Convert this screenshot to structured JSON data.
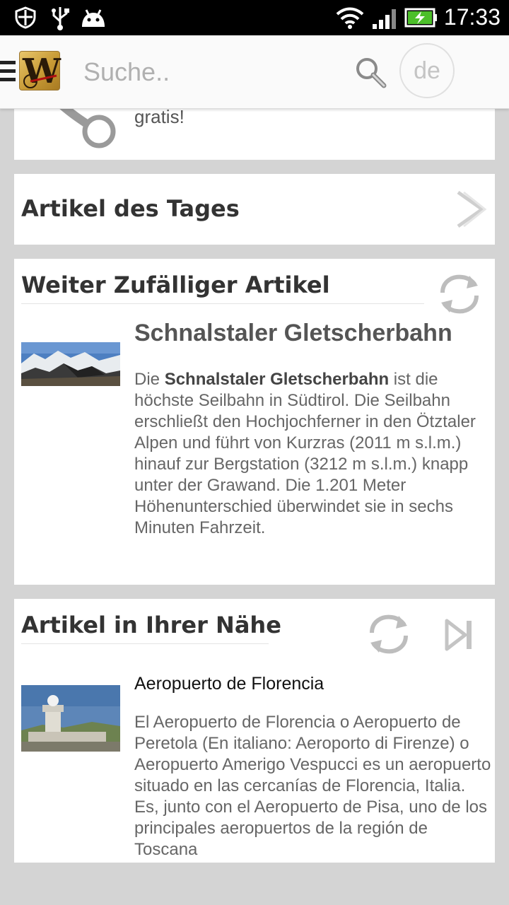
{
  "status_bar": {
    "time": "17:33",
    "icons": [
      "shield-icon",
      "usb-icon",
      "android-icon",
      "wifi-icon",
      "signal-icon",
      "battery-charging-icon"
    ]
  },
  "app_bar": {
    "logo_letter": "W",
    "search_placeholder": "Suche..",
    "language": "de",
    "icons": [
      "menu-icon",
      "search-icon"
    ]
  },
  "cards": {
    "share": {
      "text": "gratis!",
      "icon": "share-icon"
    },
    "article_of_day": {
      "title": "Artikel des Tages",
      "icon": "chevron-right-icon"
    },
    "random": {
      "title": "Weiter Zufälliger Artikel",
      "article_title": "Schnalstaler Gletscherbahn",
      "body_bold": "Schnalstaler Gletscherbahn",
      "body_prefix": "Die ",
      "body_rest": " ist die höchste Seilbahn in Südtirol. Die Seilbahn erschließt den Hochjochferner in den Ötztaler Alpen und führt von Kurzras (2011 m s.l.m.) hinauf zur Bergstation (3212 m s.l.m.) knapp unter der Grawand. Die 1.201 Meter Höhenunterschied überwindet sie in sechs Minuten Fahrzeit.",
      "icon": "refresh-icon"
    },
    "nearby": {
      "title": "Artikel in Ihrer Nähe",
      "article_title": "Aeropuerto de Florencia",
      "body": "El Aeropuerto de Florencia o Aeropuerto de Peretola (En  italiano: Aeroporto di Firenze) o Aeropuerto Amerigo Vespucci es un aeropuerto situado en las cercanías de Florencia,  Italia. Es, junto con el Aeropuerto de Pisa, uno de los principales aeropuertos de la región de  Toscana",
      "icons": [
        "refresh-icon",
        "skip-next-icon"
      ]
    }
  },
  "colors": {
    "background": "#d4d4d4",
    "card": "#ffffff",
    "appbar": "#fafafa",
    "status_bar": "#000000"
  }
}
